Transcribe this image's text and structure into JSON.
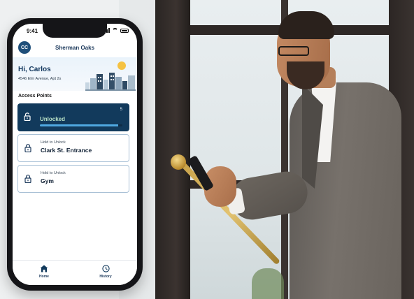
{
  "status": {
    "time": "9:41"
  },
  "header": {
    "avatar_initials": "CC",
    "location": "Sherman Oaks"
  },
  "greeting": {
    "title": "Hi, Carlos",
    "address": "4546 Elm Avenue, Apt 2s"
  },
  "access": {
    "section_title": "Access Points",
    "items": [
      {
        "state": "Unlocked",
        "count": "5",
        "progress": 0.95
      },
      {
        "hint": "Hold to Unlock",
        "name": "Clark St. Entrance"
      },
      {
        "hint": "Hold to Unlock",
        "name": "Gym"
      }
    ]
  },
  "tabs": [
    {
      "label": "Home",
      "icon": "home-icon"
    },
    {
      "label": "History",
      "icon": "clock-icon"
    }
  ],
  "colors": {
    "primary": "#123a5c",
    "accent": "#4fa8e0",
    "unlocked_text": "#b9e2c7"
  }
}
